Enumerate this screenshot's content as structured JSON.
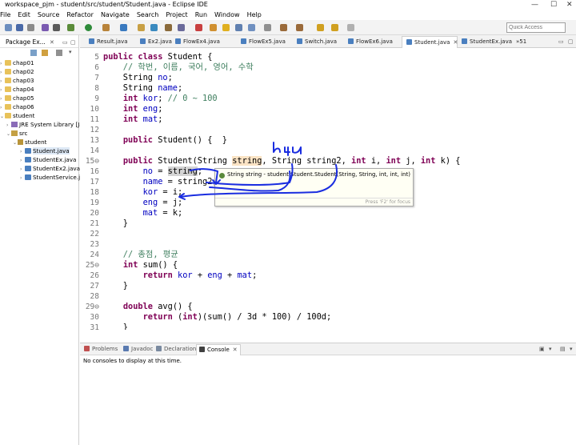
{
  "window": {
    "title": "workspace_pjm - student/src/student/Student.java - Eclipse IDE"
  },
  "menu": [
    "File",
    "Edit",
    "Source",
    "Refactor",
    "Navigate",
    "Search",
    "Project",
    "Run",
    "Window",
    "Help"
  ],
  "quick_access": {
    "placeholder": "Quick Access"
  },
  "package_explorer": {
    "title": "Package Ex...",
    "tree": [
      {
        "label": "chap01",
        "kind": "folder"
      },
      {
        "label": "chap02",
        "kind": "folder"
      },
      {
        "label": "chap03",
        "kind": "folder"
      },
      {
        "label": "chap04",
        "kind": "folder"
      },
      {
        "label": "chap05",
        "kind": "folder"
      },
      {
        "label": "chap06",
        "kind": "folder"
      },
      {
        "label": "student",
        "kind": "folder"
      },
      {
        "label": "JRE System Library [Ja",
        "kind": "lib"
      },
      {
        "label": "src",
        "kind": "src"
      },
      {
        "label": "student",
        "kind": "pkg"
      },
      {
        "label": "Student.java",
        "kind": "java"
      },
      {
        "label": "StudentEx.java",
        "kind": "java"
      },
      {
        "label": "StudentEx2.java",
        "kind": "java"
      },
      {
        "label": "StudentService.j",
        "kind": "java"
      }
    ]
  },
  "editor_tabs": [
    {
      "label": "Result.java"
    },
    {
      "label": "Ex2.java"
    },
    {
      "label": "FlowEx4.java"
    },
    {
      "label": "FlowEx5.java"
    },
    {
      "label": "Switch.java"
    },
    {
      "label": "FlowEx6.java"
    },
    {
      "label": "Student.java",
      "active": true
    },
    {
      "label": "StudentEx.java"
    },
    {
      "label": "»51"
    }
  ],
  "code": {
    "line_numbers": [
      "5",
      "6",
      "7",
      "8",
      "9",
      "10",
      "11",
      "12",
      "13",
      "14",
      "15⊖",
      "16",
      "17",
      "18",
      "19",
      "20",
      "21",
      "22",
      "23",
      "24",
      "25⊖",
      "26",
      "27",
      "28",
      "29⊖",
      "30",
      "31"
    ],
    "l5_kw1": "public",
    "l5_kw2": "class",
    "l5_rest": " Student {",
    "l6": "    // 학번, 이름, 국어, 영어, 수학",
    "l7_type": "    String ",
    "l7_f": "no",
    "l7_end": ";",
    "l8_type": "    String ",
    "l8_f": "name",
    "l8_end": ";",
    "l9_kw": "int",
    "l9_f": "kor",
    "l9_end": "; ",
    "l9_cm": "// 0 ~ 100",
    "l10_kw": "int",
    "l10_f": "eng",
    "l10_end": ";",
    "l11_kw": "int",
    "l11_f": "mat",
    "l11_end": ";",
    "l13_kw": "public",
    "l13_rest": " Student() {  }",
    "l15_kw": "public",
    "l15_a": " Student(String ",
    "l15_p1": "string",
    "l15_b": ", String string2, ",
    "l15_int1": "int",
    "l15_c": " i, ",
    "l15_int2": "int",
    "l15_d": " j, ",
    "l15_int3": "int",
    "l15_e": " k) {",
    "l16_f": "no",
    "l16_a": " = ",
    "l16_p": "string",
    "l16_end": ";",
    "l17_f": "name",
    "l17_a": " = string2;",
    "l18_f": "kor",
    "l18_a": " = i;",
    "l19_f": "eng",
    "l19_a": " = j;",
    "l20_f": "mat",
    "l20_a": " = k;",
    "l21": "    }",
    "l24": "    // 총점, 평균",
    "l25_kw": "int",
    "l25_rest": " sum() {",
    "l26_kw": "return",
    "l26_f1": "kor",
    "l26_p1": " + ",
    "l26_f2": "eng",
    "l26_p2": " + ",
    "l26_f3": "mat",
    "l26_end": ";",
    "l27": "    }",
    "l29_kw": "double",
    "l29_rest": " avg() {",
    "l30_kw": "return",
    "l30_a": " (",
    "l30_kw2": "int",
    "l30_b": ")(sum() / 3d * 100) / 100d;",
    "l31": "    }"
  },
  "hover": {
    "text": "String string - student.Student.Student(String, String, int, int, int)",
    "footer": "Press 'F2' for focus"
  },
  "annotation": {
    "handwriting": "b4u"
  },
  "bottom_tabs": [
    {
      "label": "Problems"
    },
    {
      "label": "Javadoc"
    },
    {
      "label": "Declaration"
    },
    {
      "label": "Console",
      "active": true
    }
  ],
  "console": {
    "message": "No consoles to display at this time."
  },
  "colors": {
    "keyword": "#7f0055",
    "comment": "#3f7f5f",
    "field": "#0000c0",
    "annotation": "#1a2de0"
  }
}
